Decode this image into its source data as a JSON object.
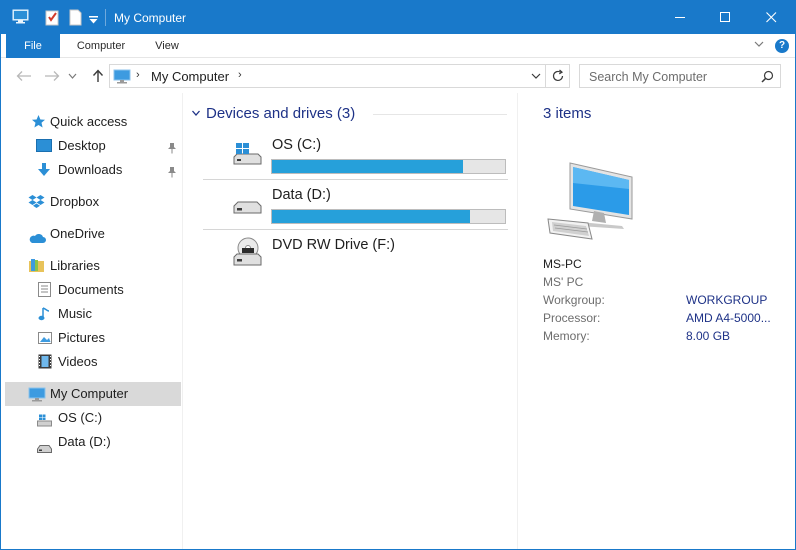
{
  "window": {
    "title": "My Computer"
  },
  "ribbon": {
    "tabs": [
      {
        "label": "File"
      },
      {
        "label": "Computer"
      },
      {
        "label": "View"
      }
    ]
  },
  "address": {
    "location": "My Computer",
    "search_placeholder": "Search My Computer"
  },
  "sidebar": {
    "quick_access": "Quick access",
    "desktop": "Desktop",
    "downloads": "Downloads",
    "dropbox": "Dropbox",
    "onedrive": "OneDrive",
    "libraries": "Libraries",
    "documents": "Documents",
    "music": "Music",
    "pictures": "Pictures",
    "videos": "Videos",
    "my_computer": "My Computer",
    "os_c": "OS (C:)",
    "data_d": "Data (D:)"
  },
  "main": {
    "group_title": "Devices and drives (3)",
    "drives": [
      {
        "name": "OS (C:)",
        "used_fraction": 0.82
      },
      {
        "name": "Data (D:)",
        "used_fraction": 0.85
      },
      {
        "name": "DVD RW Drive (F:)"
      }
    ]
  },
  "details": {
    "count": "3 items",
    "name": "MS-PC",
    "subtitle": "MS' PC",
    "props": [
      {
        "key": "Workgroup:",
        "value": "WORKGROUP"
      },
      {
        "key": "Processor:",
        "value": "AMD A4-5000..."
      },
      {
        "key": "Memory:",
        "value": "8.00 GB"
      }
    ]
  },
  "colors": {
    "accent": "#1979ca",
    "progress": "#26a0da",
    "heading": "#1e3287",
    "selection": "#d9d9d9"
  }
}
